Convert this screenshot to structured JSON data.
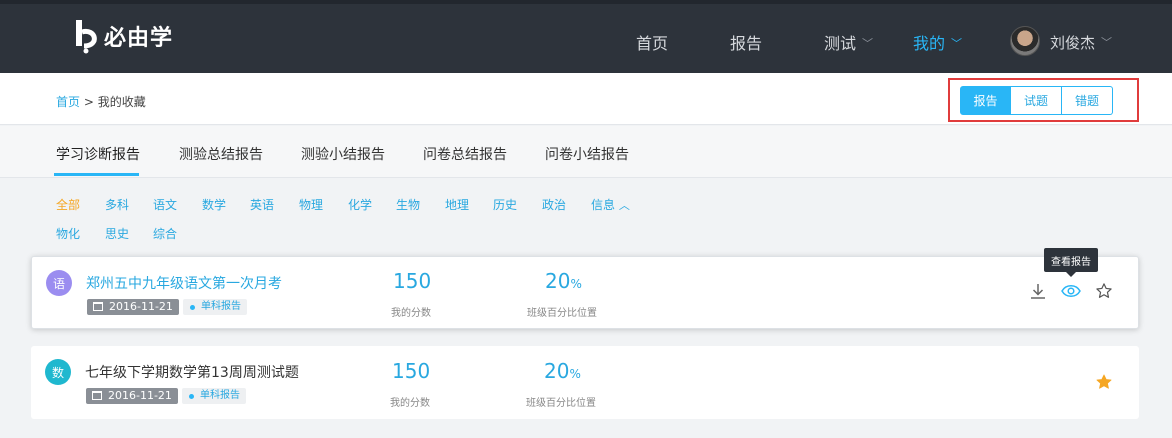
{
  "header": {
    "logo_text": "必由学",
    "nav": [
      {
        "label": "首页"
      },
      {
        "label": "报告"
      },
      {
        "label": "测试"
      },
      {
        "label": "我的"
      }
    ],
    "user_name": "刘俊杰"
  },
  "breadcrumb": {
    "home": "首页",
    "separator": ">",
    "current": "我的收藏"
  },
  "segmented": {
    "options": [
      "报告",
      "试题",
      "错题"
    ],
    "selected": "报告"
  },
  "tabs": [
    "学习诊断报告",
    "测验总结报告",
    "测验小结报告",
    "问卷总结报告",
    "问卷小结报告"
  ],
  "subjects": {
    "row1": [
      "全部",
      "多科",
      "语文",
      "数学",
      "英语",
      "物理",
      "化学",
      "生物",
      "地理",
      "历史",
      "政治",
      "信息"
    ],
    "row2": [
      "物化",
      "思史",
      "综合"
    ],
    "selected": "全部"
  },
  "tooltip": "查看报告",
  "reports": [
    {
      "badge": "语",
      "badge_color": "#9b8df0",
      "title": "郑州五中九年级语文第一次月考",
      "date": "2016-11-21",
      "type": "单科报告",
      "score": "150",
      "score_label": "我的分数",
      "percent": "20",
      "percent_unit": "%",
      "percent_label": "班级百分比位置",
      "starred": false
    },
    {
      "badge": "数",
      "badge_color": "#1fb8cf",
      "title": "七年级下学期数学第13周周测试题",
      "date": "2016-11-21",
      "type": "单科报告",
      "score": "150",
      "score_label": "我的分数",
      "percent": "20",
      "percent_unit": "%",
      "percent_label": "班级百分比位置",
      "starred": true
    }
  ],
  "colors": {
    "accent": "#29b6f6",
    "star": "#f5a623",
    "header_bg": "#2d333b"
  }
}
